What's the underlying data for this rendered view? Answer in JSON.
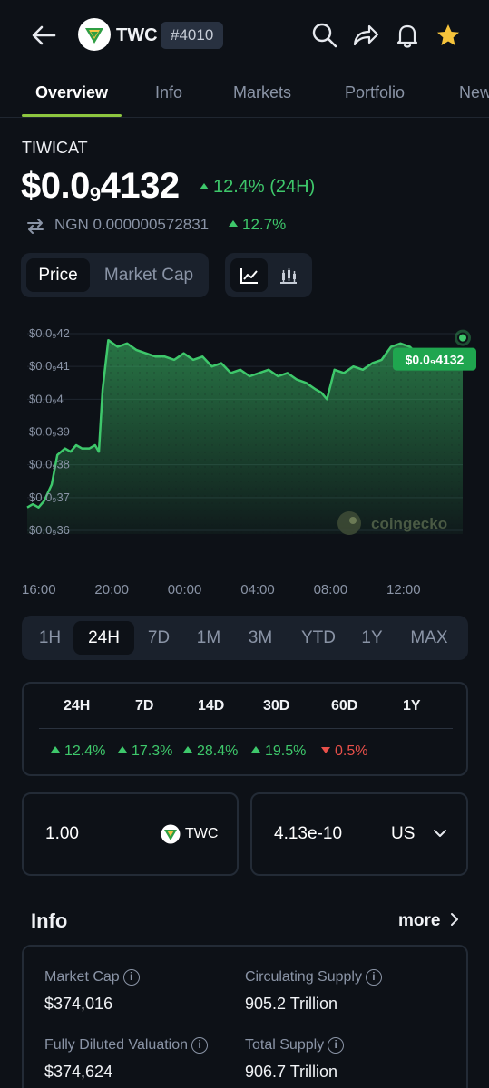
{
  "header": {
    "symbol": "TWC",
    "rank": "#4010"
  },
  "tabs": [
    "Overview",
    "Info",
    "Markets",
    "Portfolio",
    "New"
  ],
  "coin": {
    "name": "TIWICAT",
    "price_prefix": "$0.0",
    "price_zeros": "9",
    "price_suffix": "4132",
    "change_24h": "12.4% (24H)",
    "ngn_value": "NGN 0.000000572831",
    "ngn_change": "12.7%"
  },
  "chart_toggle": {
    "price": "Price",
    "market_cap": "Market Cap"
  },
  "chart_data": {
    "type": "area",
    "y_tick_labels": [
      "$0.0₉42",
      "$0.0₉41",
      "$0.0₉4",
      "$0.0₉39",
      "$0.0₉38",
      "$0.0₉37",
      "$0.0₉36"
    ],
    "y_ticks": [
      4.2e-10,
      4.1e-10,
      4e-10,
      3.9e-10,
      3.8e-10,
      3.7e-10,
      3.6e-10
    ],
    "ylim": [
      3.6e-10,
      4.2e-10
    ],
    "x_tick_labels": [
      "16:00",
      "20:00",
      "00:00",
      "04:00",
      "08:00",
      "12:00"
    ],
    "x_hours": [
      16,
      20,
      24,
      28,
      32,
      36
    ],
    "current_label": "$0.0₉4132",
    "current_value": 4.132e-10,
    "watermark": "coingecko",
    "color": "#3ec86b",
    "x": [
      15.7,
      16.0,
      16.3,
      16.6,
      17.0,
      17.3,
      17.7,
      18.0,
      18.3,
      18.6,
      19.0,
      19.3,
      19.5,
      19.7,
      20.0,
      20.5,
      21.0,
      21.5,
      22.0,
      22.5,
      23.0,
      23.5,
      24.0,
      24.5,
      25.0,
      25.5,
      26.0,
      26.5,
      27.0,
      27.5,
      28.0,
      28.5,
      29.0,
      29.5,
      30.0,
      30.5,
      31.0,
      31.3,
      31.6,
      32.0,
      32.5,
      33.0,
      33.5,
      34.0,
      34.5,
      35.0,
      35.5,
      36.0,
      36.5,
      37.0,
      37.5,
      38.0,
      38.5,
      38.8
    ],
    "y": [
      3.67e-10,
      3.68e-10,
      3.67e-10,
      3.69e-10,
      3.74e-10,
      3.83e-10,
      3.85e-10,
      3.84e-10,
      3.86e-10,
      3.85e-10,
      3.85e-10,
      3.86e-10,
      3.84e-10,
      4.03e-10,
      4.18e-10,
      4.16e-10,
      4.17e-10,
      4.15e-10,
      4.14e-10,
      4.13e-10,
      4.13e-10,
      4.12e-10,
      4.14e-10,
      4.12e-10,
      4.13e-10,
      4.1e-10,
      4.11e-10,
      4.08e-10,
      4.09e-10,
      4.07e-10,
      4.08e-10,
      4.09e-10,
      4.07e-10,
      4.08e-10,
      4.06e-10,
      4.05e-10,
      4.03e-10,
      4.02e-10,
      4e-10,
      4.09e-10,
      4.08e-10,
      4.1e-10,
      4.09e-10,
      4.11e-10,
      4.12e-10,
      4.16e-10,
      4.17e-10,
      4.16e-10,
      4.13e-10,
      4.14e-10,
      4.11e-10,
      4.13e-10,
      4.12e-10,
      4.132e-10
    ]
  },
  "ranges": [
    "1H",
    "24H",
    "7D",
    "1M",
    "3M",
    "YTD",
    "1Y",
    "MAX"
  ],
  "performance": {
    "headers": [
      "24H",
      "7D",
      "14D",
      "30D",
      "60D",
      "1Y"
    ],
    "values": [
      {
        "text": "12.4%",
        "dir": "up"
      },
      {
        "text": "17.3%",
        "dir": "up"
      },
      {
        "text": "28.4%",
        "dir": "up"
      },
      {
        "text": "19.5%",
        "dir": "up"
      },
      {
        "text": "0.5%",
        "dir": "down"
      }
    ]
  },
  "converter": {
    "amount": "1.00",
    "coin": "TWC",
    "result": "4.13e-10",
    "currency": "US"
  },
  "info": {
    "title": "Info",
    "more": "more",
    "market_cap_label": "Market Cap",
    "market_cap": "$374,016",
    "circulating_label": "Circulating Supply",
    "circulating": "905.2 Trillion",
    "fdv_label": "Fully Diluted Valuation",
    "fdv": "$374,624",
    "total_supply_label": "Total Supply",
    "total_supply": "906.7 Trillion"
  },
  "colors": {
    "accent": "#8dc63f",
    "up": "#3ec86b",
    "down": "#e8504a",
    "background": "#0d1117"
  }
}
